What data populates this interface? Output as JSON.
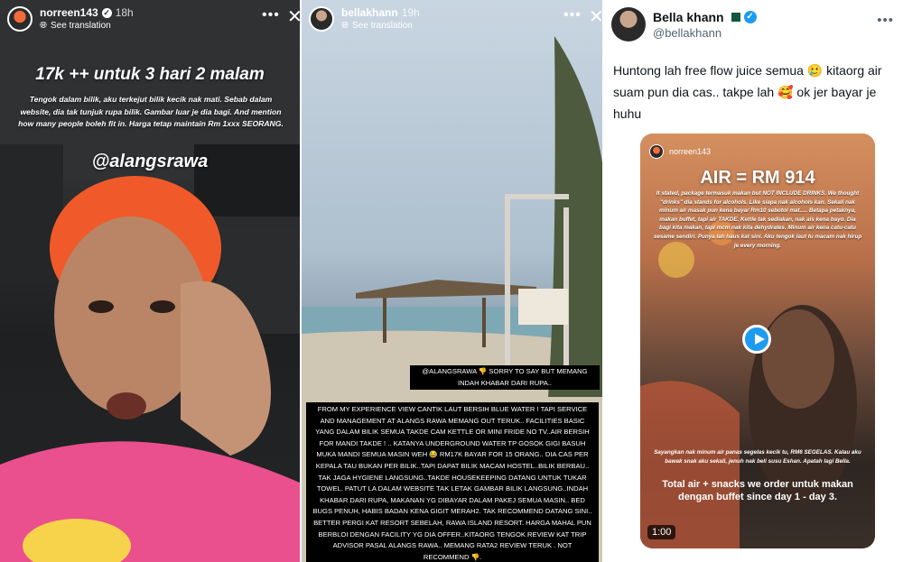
{
  "story1": {
    "username": "norreen143",
    "time": "18h",
    "translation": "See translation",
    "title": "17k ++ untuk 3 hari 2 malam",
    "body": "Tengok dalam bilik, aku terkejut bilik kecik nak mati. Sebab dalam website, dia tak tunjuk rupa bilik. Gambar luar je dia bagi. And mention how many people boleh fit in. Harga tetap maintain Rm 1xxx SEORANG.",
    "mention": "@alangsrawa"
  },
  "story2": {
    "username": "bellakhann",
    "time": "19h",
    "translation": "See translation",
    "caption1": "@ALANGSRAWA 👎 SORRY TO SAY BUT MEMANG INDAH KHABAR DARI RUPA..",
    "caption2": "FROM MY EXPERIENCE VIEW CANTIK LAUT BERSIH BLUE WATER ! TAPI SERVICE AND MANAGEMENT AT ALANGS RAWA MEMANG OUT TERUK.. FACILITIES BASIC YANG DALAM BILIK SEMUA TAKDE CAM KETTLE OR MINI FRIDE NO TV..AIR BERSIH FOR MANDI TAKDE ! .. KATANYA UNDERGROUND WATER TP GOSOK GIGI BASUH MUKA MANDI SEMUA MASIN WEH 😂 RM17K BAYAR FOR 15 ORANG.. DIA CAS PER KEPALA TAU BUKAN PER BILIK..TAPI DAPAT BILIK MACAM HOSTEL..BILIK BERBAU.. TAK JAGA HYGIENE LANGSUNG..TAKDE HOUSEKEEPING DATANG UNTUK TUKAR TOWEL. PATUT LA DALAM WEBSITE TAK LETAK GAMBAR BILIK LANGSUNG..INDAH KHABAR DARI RUPA, MAKANAN YG DIBAYAR DALAM PAKEJ SEMUA MASIN.. BED BUGS PENUH, HABIS BADAN KENA GIGIT MERAH2. TAK RECOMMEND DATANG SINI.. BETTER PERGI KAT RESORT SEBELAH, RAWA ISLAND RESORT. HARGA MAHAL PUN BERBLOI DENGAN FACILITY YG DIA OFFER..KITAORG TENGOK REVIEW KAT TRIP ADVISOR PASAL ALANGS RAWA.. MEMANG RATA2 REVIEW TERUK . NOT RECOMMEND 👎."
  },
  "tweet": {
    "name": "Bella khann",
    "handle": "@bellakhann",
    "text": "Huntong lah free flow juice semua 🥲 kitaorg air suam pun dia cas.. takpe lah 🥰 ok jer bayar je huhu",
    "media": {
      "username": "norreen143",
      "title": "AIR = RM 914",
      "body": "It stated, package termasuk makan but NOT INCLUDE DRINKS. We thought \"drinks\" dia stands for alcohols. Like siapa nak alcohols kan. Sekali nak minum air masak pun kena bayar Rm10 sebotol mat..... Betapa petaknya, makan buffet, tapi air TAKDE. Kettle tak sediakan, nak ais kena bayo. Dia bagi kita makan, tapi mcm nak kita dehydrates. Minum air kena catu-catu sesame sendiri. Punya lah haus kat sini. Aku tengok laut tu macam nak hirup je every morning.",
      "lower": "Sayangkan nak minum air panas segelas kecik tu, RM6 SEGELAS. Kalau aku bawak snak aku sekali, jenuh nak beli susu Eshan. Apatah lagi Bella.",
      "big": "Total air + snacks we order untuk makan dengan buffet since day 1 - day 3.",
      "duration": "1:00"
    }
  },
  "colors": {
    "twitter_blue": "#1d9bf0",
    "caption_bg": "#000000"
  }
}
